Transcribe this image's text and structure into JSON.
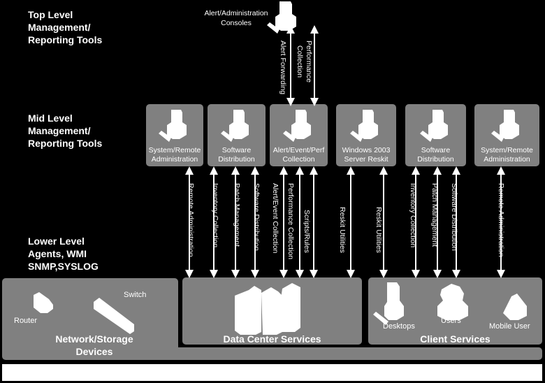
{
  "tiers": {
    "top": "Top Level\nManagement/\nReporting Tools",
    "mid": "Mid Level\nManagement/\nReporting Tools",
    "lower": "Lower Level\nAgents, WMI\nSNMP,SYSLOG"
  },
  "console": {
    "label": "Alert/Administration\nConsoles",
    "icon": "workstation-icon"
  },
  "top_links": [
    "Alert Forwarding",
    "Performance\nCollection"
  ],
  "mid_boxes": [
    {
      "label": "System/Remote\nAdministration"
    },
    {
      "label": "Software\nDistribution"
    },
    {
      "label": "Alert/Event/Perf\nCollection"
    },
    {
      "label": "Windows 2003\nServer Reskit"
    },
    {
      "label": "Software\nDistribution"
    },
    {
      "label": "System/Remote\nAdministration"
    }
  ],
  "links": [
    "Remote Administration",
    "Inventory Collection",
    "Patch Management",
    "Software Distribution",
    "Alert/Event Collection",
    "Performance Collection",
    "Scripts/Rules",
    "Reskit Utilities",
    "Reskit Utilities",
    "Inventory Collection",
    "Patch Management",
    "Software Distribution",
    "Remote Administration"
  ],
  "network": {
    "title": "Network/Storage\nDevices",
    "router": "Router",
    "switch": "Switch"
  },
  "datacenter": {
    "title": "Data Center Services"
  },
  "client": {
    "title": "Client Services",
    "desktops": "Desktops",
    "users": "Users",
    "mobile": "Mobile User"
  },
  "colors": {
    "panel": "#808080",
    "background": "#000000",
    "foreground": "#ffffff"
  }
}
